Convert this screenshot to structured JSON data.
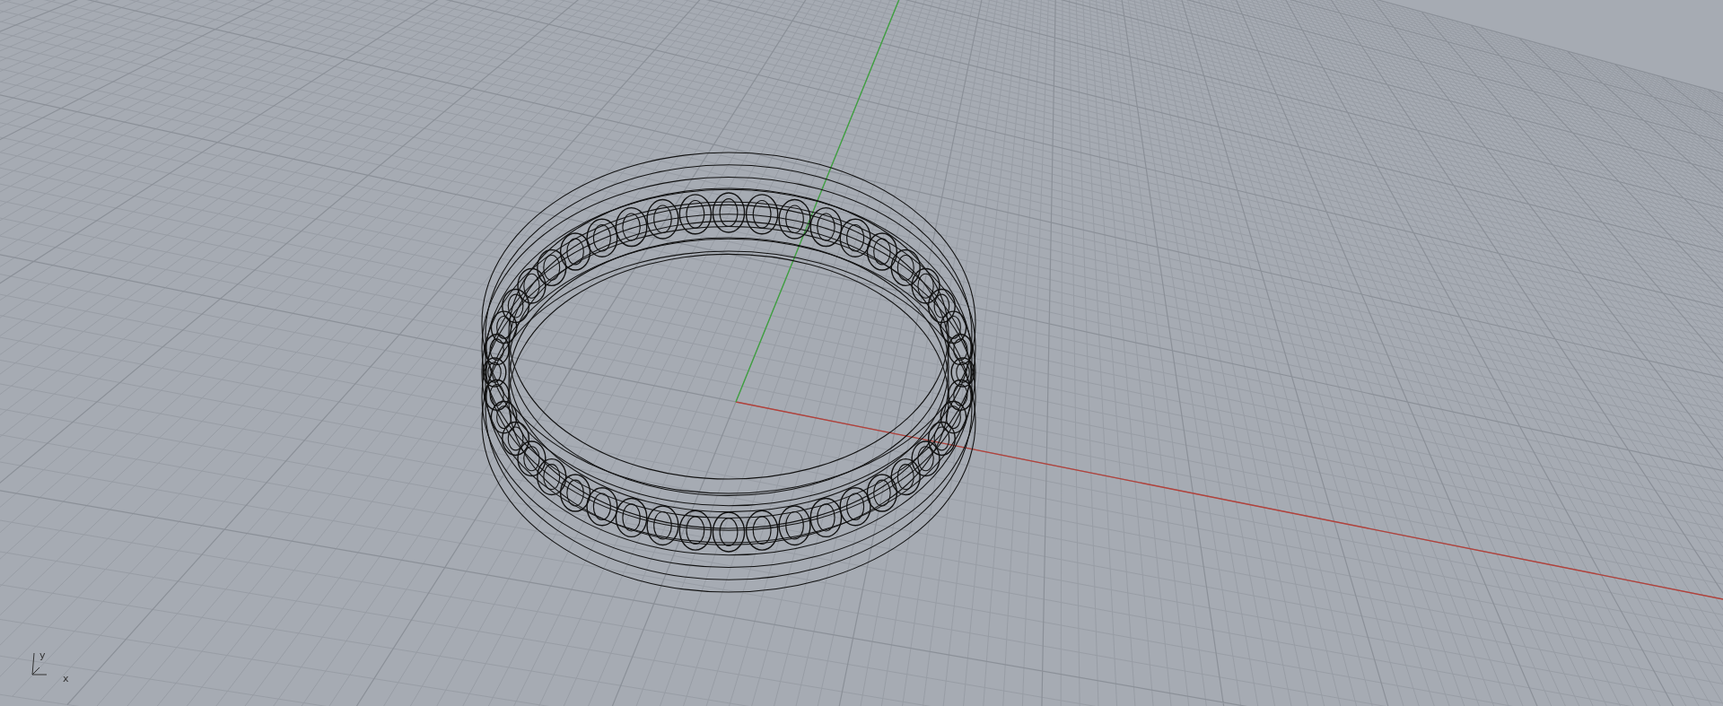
{
  "viewport": {
    "axis_indicator": {
      "labels": [
        "y",
        "x"
      ]
    }
  }
}
